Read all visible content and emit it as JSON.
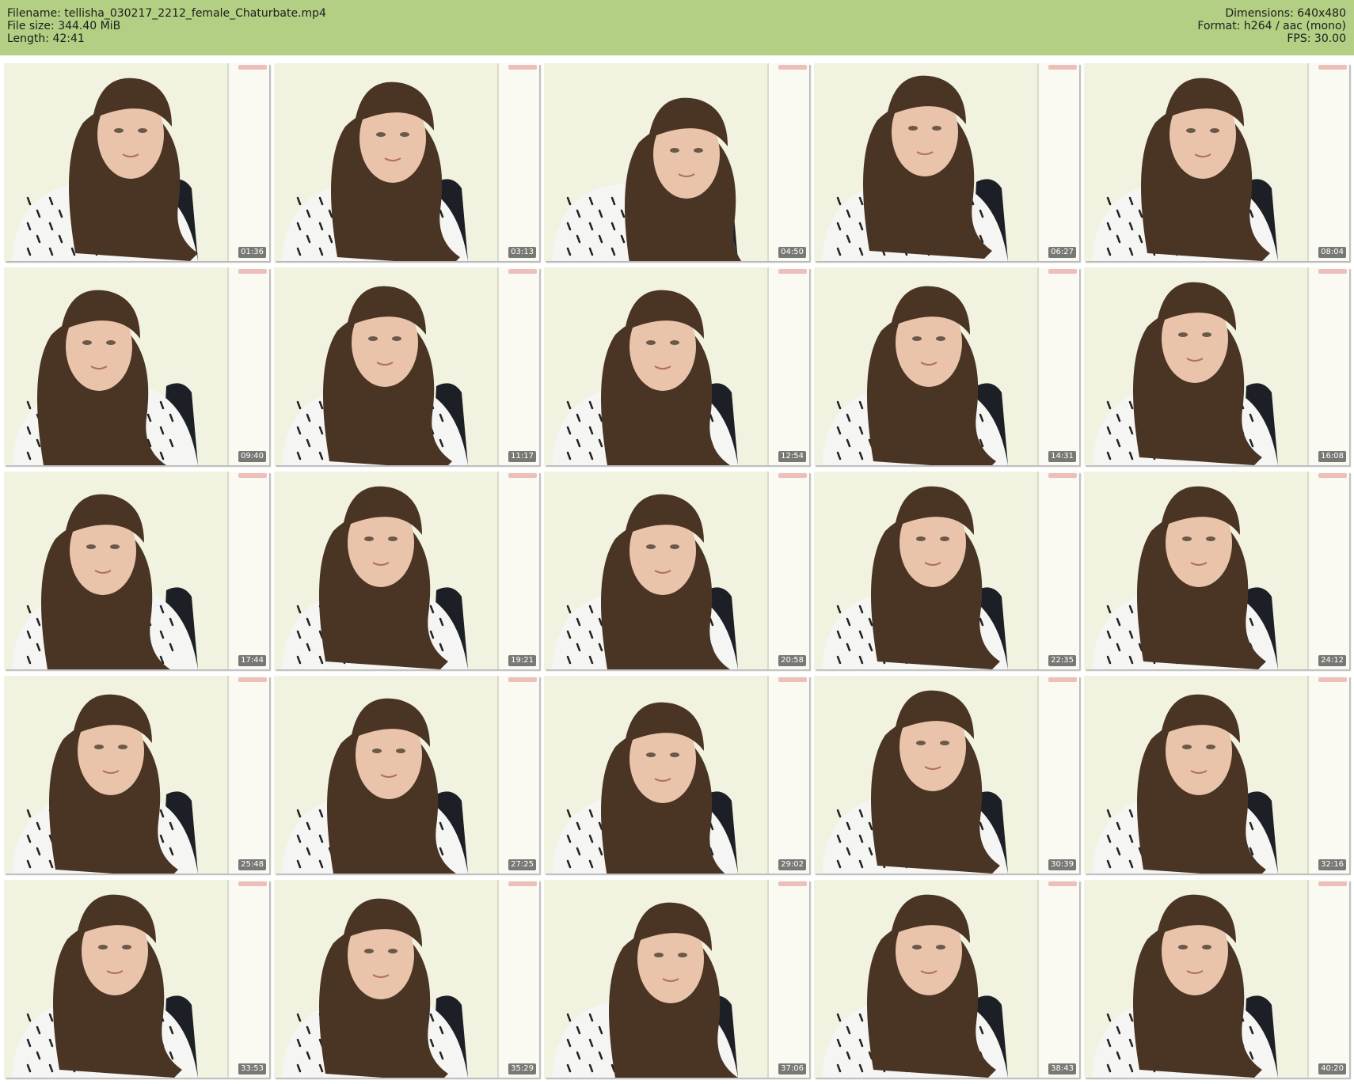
{
  "header": {
    "filename_line": "Filename: tellisha_030217_2212_female_Chaturbate.mp4",
    "filesize_line": "File size: 344.40 MiB",
    "length_line": "Length: 42:41",
    "dimensions_line": "Dimensions: 640x480",
    "format_line": "Format: h264 / aac (mono)",
    "fps_line": "FPS: 30.00"
  },
  "colors": {
    "header_bg": "#b2cf84",
    "wall": "#f1f2e0",
    "hair": "#4a3424",
    "shirt": "#f5f5f3",
    "chair": "#1c1f26"
  },
  "thumbnails": [
    {
      "timestamp": "01:36"
    },
    {
      "timestamp": "03:13"
    },
    {
      "timestamp": "04:50"
    },
    {
      "timestamp": "06:27"
    },
    {
      "timestamp": "08:04"
    },
    {
      "timestamp": "09:40"
    },
    {
      "timestamp": "11:17"
    },
    {
      "timestamp": "12:54"
    },
    {
      "timestamp": "14:31"
    },
    {
      "timestamp": "16:08"
    },
    {
      "timestamp": "17:44"
    },
    {
      "timestamp": "19:21"
    },
    {
      "timestamp": "20:58"
    },
    {
      "timestamp": "22:35"
    },
    {
      "timestamp": "24:12"
    },
    {
      "timestamp": "25:48"
    },
    {
      "timestamp": "27:25"
    },
    {
      "timestamp": "29:02"
    },
    {
      "timestamp": "30:39"
    },
    {
      "timestamp": "32:16"
    },
    {
      "timestamp": "33:53"
    },
    {
      "timestamp": "35:29"
    },
    {
      "timestamp": "37:06"
    },
    {
      "timestamp": "38:43"
    },
    {
      "timestamp": "40:20"
    }
  ]
}
